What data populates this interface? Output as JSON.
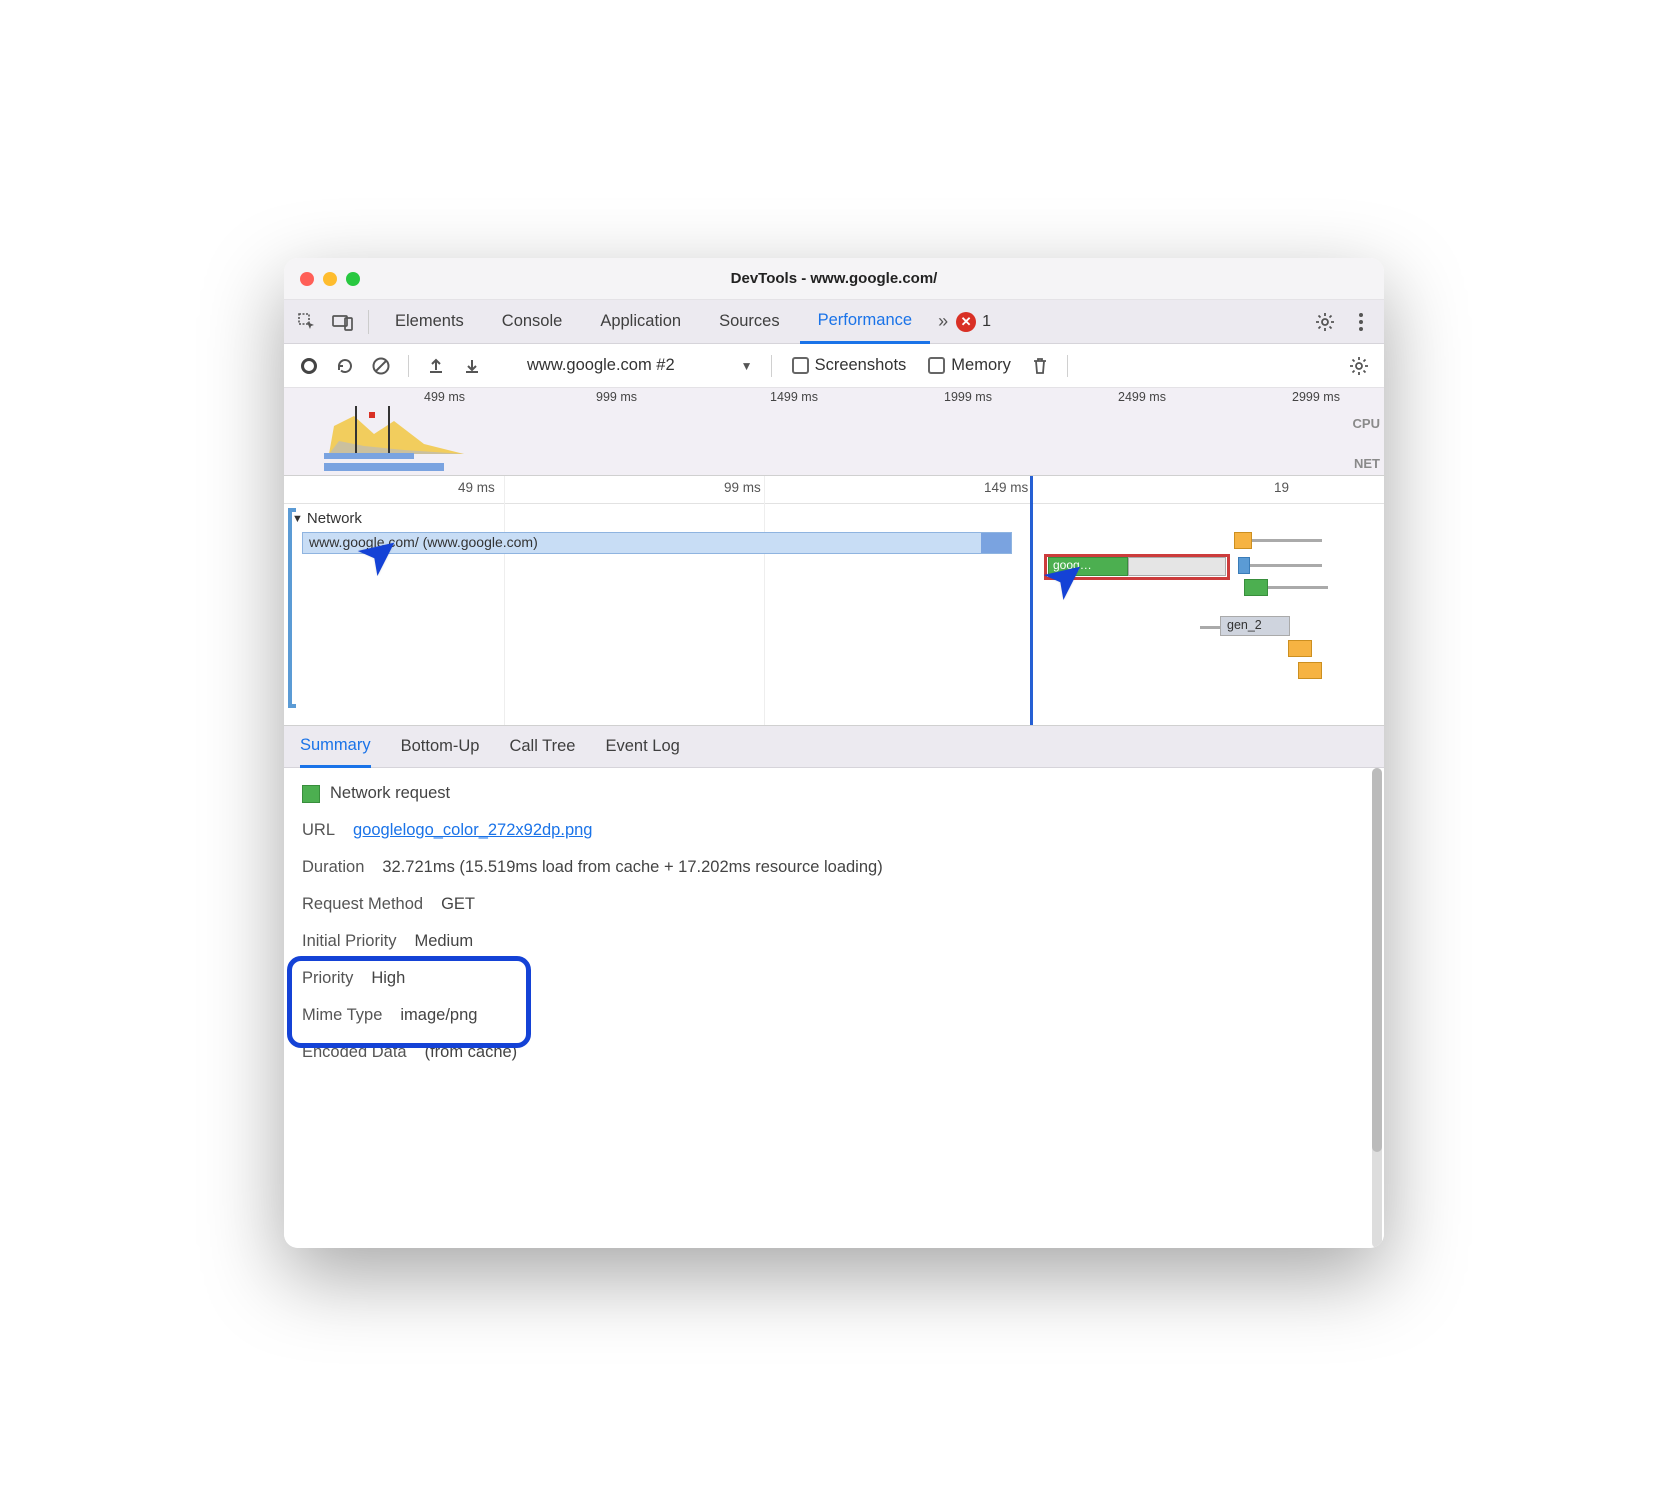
{
  "window_title": "DevTools - www.google.com/",
  "tabs": {
    "items": [
      "Elements",
      "Console",
      "Application",
      "Sources",
      "Performance"
    ],
    "active": "Performance",
    "error_count": "1"
  },
  "toolbar": {
    "session": "www.google.com #2",
    "screenshots_label": "Screenshots",
    "memory_label": "Memory"
  },
  "overview": {
    "ticks": [
      "499 ms",
      "999 ms",
      "1499 ms",
      "1999 ms",
      "2499 ms",
      "2999 ms"
    ],
    "cpu_label": "CPU",
    "net_label": "NET"
  },
  "flame": {
    "ticks": [
      "49 ms",
      "99 ms",
      "149 ms",
      "19"
    ],
    "network_hdr": "Network",
    "main_bar": "www.google.com/ (www.google.com)",
    "sel_bar": "goog…",
    "gen2": "gen_2"
  },
  "detail_tabs": [
    "Summary",
    "Bottom-Up",
    "Call Tree",
    "Event Log"
  ],
  "summary": {
    "section_title": "Network request",
    "url_label": "URL",
    "url_value": "googlelogo_color_272x92dp.png",
    "duration_label": "Duration",
    "duration_value": "32.721ms (15.519ms load from cache + 17.202ms resource loading)",
    "method_label": "Request Method",
    "method_value": "GET",
    "init_priority_label": "Initial Priority",
    "init_priority_value": "Medium",
    "priority_label": "Priority",
    "priority_value": "High",
    "mime_label": "Mime Type",
    "mime_value": "image/png",
    "encoded_label": "Encoded Data",
    "encoded_value": "(from cache)"
  }
}
